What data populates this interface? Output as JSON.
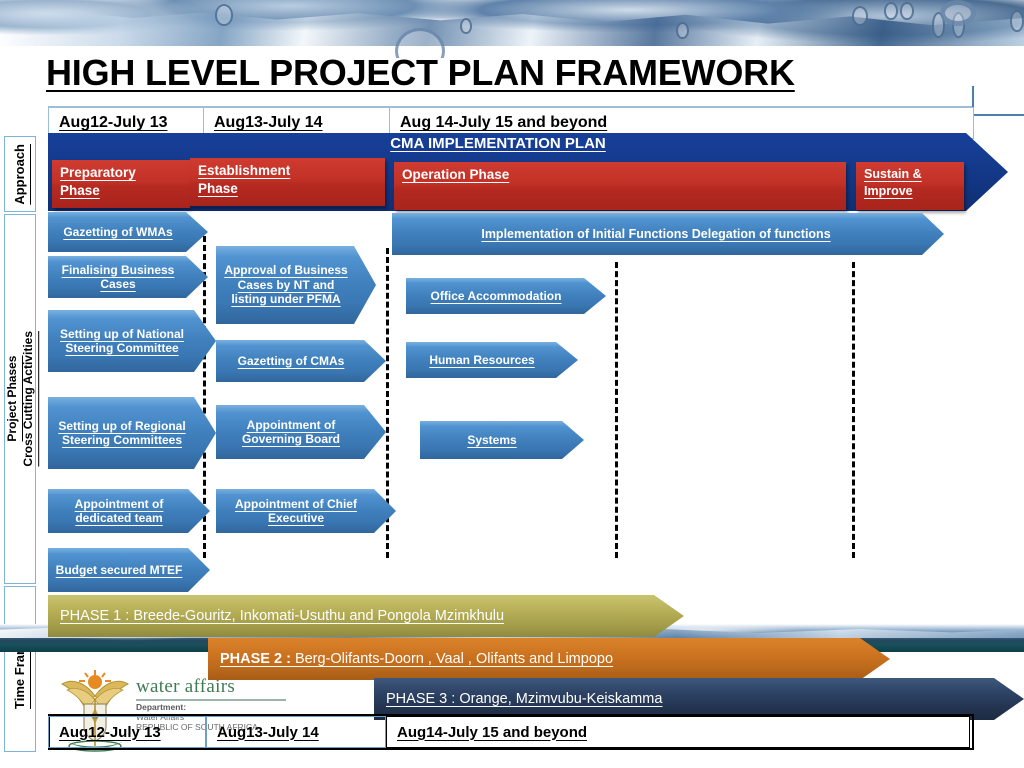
{
  "slide": {
    "title": "HIGH LEVEL PROJECT PLAN FRAMEWORK"
  },
  "top_dates": [
    {
      "label": "Aug12-July 13"
    },
    {
      "label": "Aug13-July 14"
    },
    {
      "label": "Aug 14-July 15 and beyond"
    }
  ],
  "cma": {
    "banner_label": "CMA IMPLEMENTATION PLAN"
  },
  "side_labels": {
    "approach": "Approach",
    "project_phases": "Project Phases\nCross Cutting Activities",
    "time_frames": "Time Frames"
  },
  "approach_phases": [
    {
      "label": "Preparatory Phase",
      "line1": "Preparatory",
      "line2": "Phase"
    },
    {
      "label": "Establishment Phase",
      "line1": "Establishment",
      "line2": "Phase"
    },
    {
      "label": "Operation Phase",
      "line1": "Operation Phase",
      "line2": ""
    },
    {
      "label": "Sustain & Improve",
      "line1": "Sustain &",
      "line2": "Improve"
    }
  ],
  "activities": {
    "column1": [
      {
        "label": "Gazetting of WMAs"
      },
      {
        "label": "Finalising Business Cases"
      },
      {
        "label": "Setting up of National Steering Committee"
      },
      {
        "label": "Setting up of Regional Steering Committees"
      },
      {
        "label": "Appointment of dedicated team"
      },
      {
        "label": "Budget secured MTEF"
      }
    ],
    "column2": [
      {
        "label": "Approval of Business Cases by NT and listing under PFMA"
      },
      {
        "label": "Gazetting of  CMAs"
      },
      {
        "label": "Appointment of Governing Board"
      },
      {
        "label": "Appointment of Chief Executive"
      }
    ],
    "column3": [
      {
        "label": "Implementation of Initial Functions Delegation of functions"
      },
      {
        "label": "Office Accommodation"
      },
      {
        "label": "Human Resources"
      },
      {
        "label": "Systems"
      }
    ]
  },
  "phase_bars": [
    {
      "prefix": "PHASE 1 : ",
      "text": "Breede-Gouritz, Inkomati-Usuthu and Pongola Mzimkhulu",
      "color": "#b5ae55"
    },
    {
      "prefix": "PHASE 2 : ",
      "text": "Berg-Olifants-Doorn , Vaal , Olifants and Limpopo",
      "color": "#cc7320"
    },
    {
      "prefix": "PHASE 3 : ",
      "text": "Orange, Mzimvubu-Keiskamma",
      "color": "#2c4163"
    }
  ],
  "bottom_dates": [
    {
      "label": "Aug12-July 13"
    },
    {
      "label": "Aug13-July 14"
    },
    {
      "label": "Aug14-July 15 and beyond"
    }
  ],
  "logo": {
    "main": "water affairs",
    "sub_line1": "Department:",
    "sub_line2": "Water Affairs",
    "sub_line3": "REPUBLIC OF SOUTH AFRICA",
    "crest_name": "south-african-coat-of-arms"
  },
  "colors": {
    "navy": "#143a8c",
    "red": "#c23127",
    "blue": "#3f80bd",
    "olive": "#b5ae55",
    "orange": "#cc7320",
    "darknavy": "#2c4163"
  }
}
